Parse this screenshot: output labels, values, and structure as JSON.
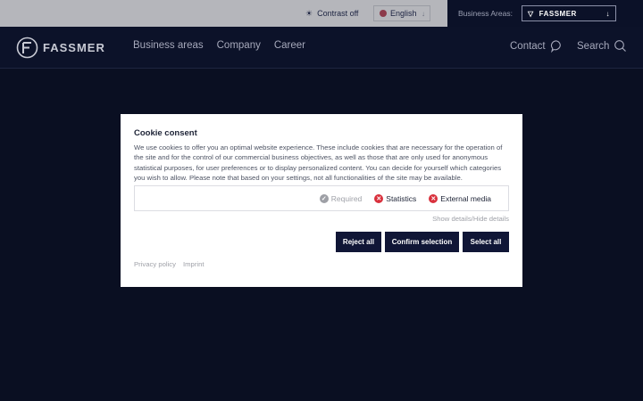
{
  "topbar": {
    "contrast_label": "Contrast off",
    "language_label": "English",
    "business_areas_label": "Business Areas:",
    "business_select_value": "FASSMER"
  },
  "header": {
    "logo_text": "FASSMER",
    "nav": [
      "Business areas",
      "Company",
      "Career"
    ],
    "contact_label": "Contact",
    "search_label": "Search"
  },
  "cookie": {
    "title": "Cookie consent",
    "body": "We use cookies to offer you an optimal website experience. These include cookies that are necessary for the operation of the site and for the control of our commercial business objectives, as well as those that are only used for anonymous statistical purposes, for user preferences or to display personalized content. You can decide for yourself which categories you wish to allow. Please note that based on your settings, not all functionalities of the site may be available.",
    "options": [
      {
        "label": "Required",
        "state": "required"
      },
      {
        "label": "Statistics",
        "state": "off"
      },
      {
        "label": "External media",
        "state": "off"
      }
    ],
    "details_link": "Show details/Hide details",
    "buttons": {
      "reject": "Reject all",
      "confirm": "Confirm selection",
      "select_all": "Select all"
    },
    "footer_links": [
      "Privacy policy",
      "Imprint"
    ]
  },
  "colors": {
    "page_bg": "#0a0f22",
    "button_bg": "#101636",
    "off_icon": "#d9303c",
    "required_icon": "#9ea0a6"
  }
}
